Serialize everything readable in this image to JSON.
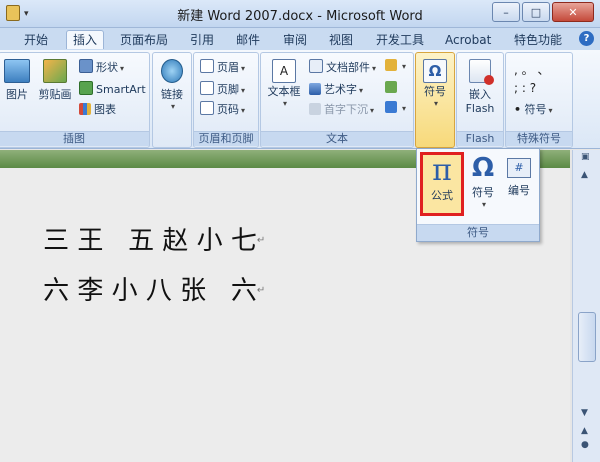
{
  "window": {
    "title": "新建 Word 2007.docx - Microsoft Word",
    "minimize": "–",
    "maximize": "□",
    "close": "✕"
  },
  "tabs": [
    "开始",
    "插入",
    "页面布局",
    "引用",
    "邮件",
    "审阅",
    "视图",
    "开发工具",
    "Acrobat",
    "特色功能"
  ],
  "active_tab": "插入",
  "help": "?",
  "ribbon": {
    "illustrations": {
      "label": "插图",
      "picture": "图片",
      "clipart": "剪贴画",
      "shapes": "形状",
      "smartart": "SmartArt",
      "chart": "图表"
    },
    "links": {
      "label": "链接"
    },
    "header_footer": {
      "label": "页眉和页脚",
      "header": "页眉",
      "footer": "页脚",
      "page_number": "页码"
    },
    "text": {
      "label": "文本",
      "textbox": "文本框",
      "quick_parts": "文档部件",
      "wordart": "艺术字",
      "dropcap": "首字下沉"
    },
    "symbols": {
      "symbol": "符号"
    },
    "flash": {
      "label": "Flash",
      "insert": "嵌入",
      "flash": "Flash"
    },
    "special": {
      "label": "特殊符号",
      "symbol": "符号",
      "row1": ",  。  、",
      "row2": ";  :  ?"
    }
  },
  "popup": {
    "label": "符号",
    "equation": "公式",
    "symbol": "符号",
    "number": "编号"
  },
  "document": {
    "line1": "三 王   五 赵 小 七",
    "line2": "六 李 小 八 张   六",
    "mark": "↵"
  },
  "colors": {
    "highlight_border": "#e02020",
    "highlight_fill": "#fbe6a2",
    "ribbon_bg": "#dbe7f6"
  }
}
